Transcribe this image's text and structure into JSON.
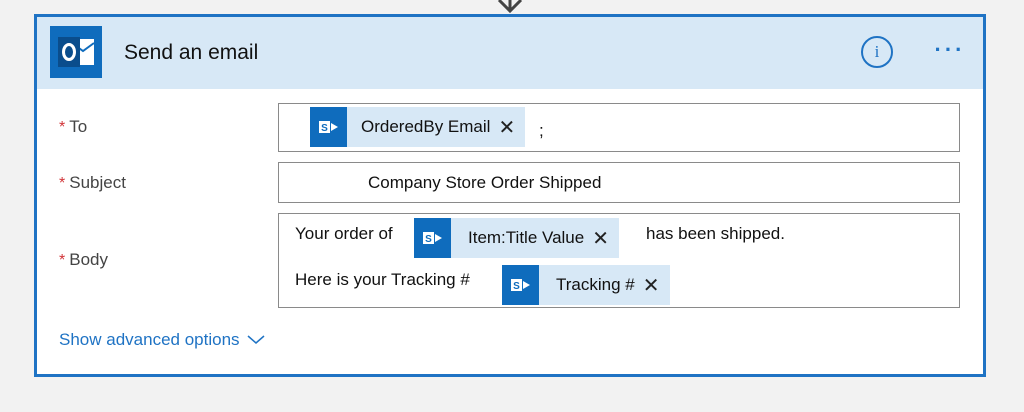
{
  "card": {
    "title": "Send an email",
    "app_icon": "outlook-icon",
    "info_label": "i",
    "more_label": "···"
  },
  "fields": {
    "to": {
      "label": "To",
      "required_marker": "*",
      "token_label": "OrderedBy Email",
      "token_remove": "✕",
      "separator": ";"
    },
    "subject": {
      "label": "Subject",
      "required_marker": "*",
      "value": "Company Store Order Shipped"
    },
    "body": {
      "label": "Body",
      "required_marker": "*",
      "line1_prefix": "Your order of",
      "line1_token": "Item:Title Value",
      "line1_token_remove": "✕",
      "line1_suffix": "has been shipped.",
      "line2_prefix": "Here is your Tracking #",
      "line2_token": "Tracking #",
      "line2_token_remove": "✕"
    }
  },
  "advanced": {
    "label": "Show advanced options"
  },
  "colors": {
    "accent": "#1f73c4",
    "header_bg": "#d7e8f6",
    "token_bg": "#d7e8f6",
    "icon_bg": "#0f6cbd",
    "required": "#d13438"
  },
  "icons": {
    "token": "sharepoint-icon",
    "advanced": "chevron-down-icon",
    "connector": "down-arrow-icon"
  }
}
